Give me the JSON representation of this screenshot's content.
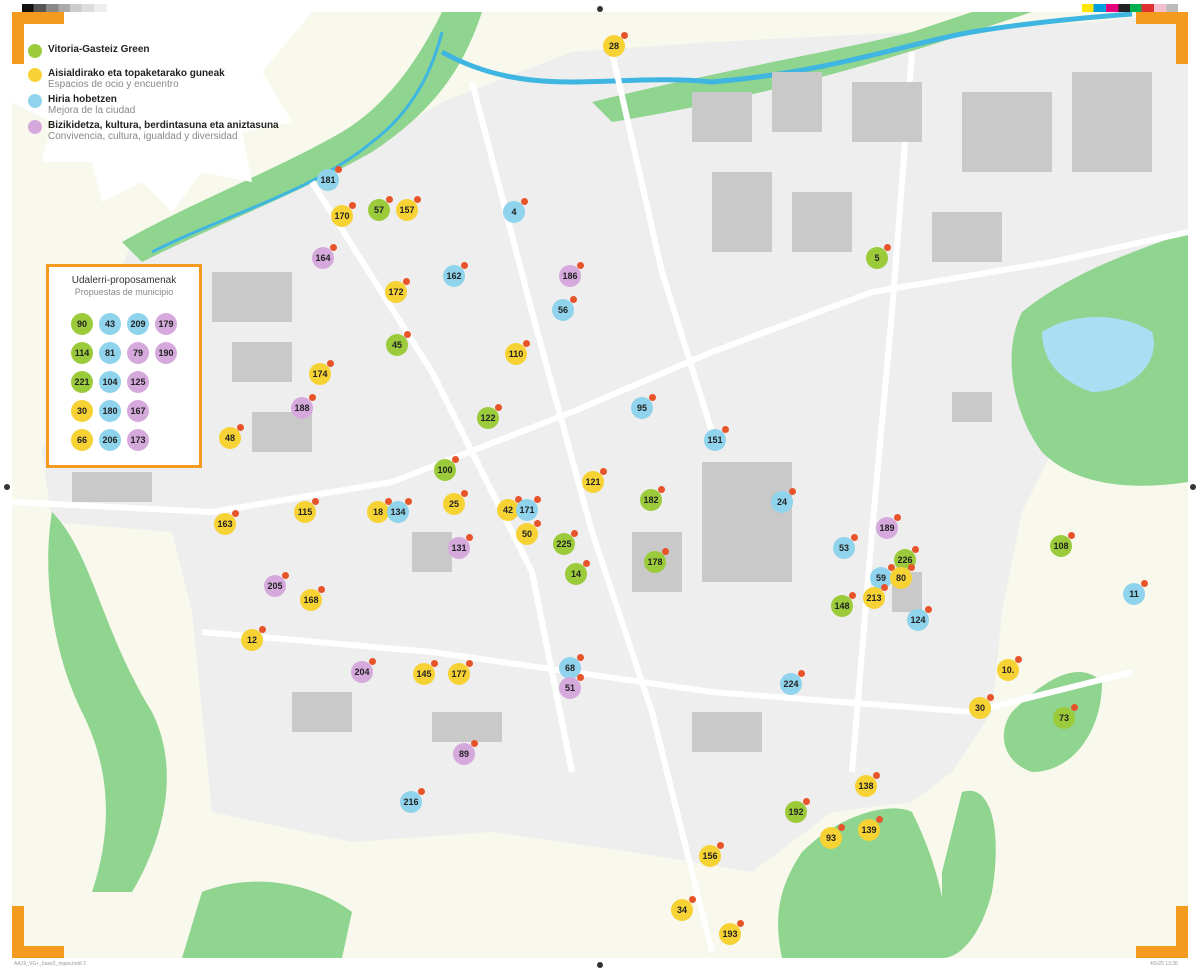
{
  "legend": {
    "items": [
      {
        "title": "Vitoria-Gasteiz Green",
        "subtitle": "",
        "color": "#9bcb3b"
      },
      {
        "title": "Aisialdirako eta topaketarako guneak",
        "subtitle": "Espacios de ocio y encuentro",
        "color": "#f7d234"
      },
      {
        "title": "Hiria hobetzen",
        "subtitle": "Mejora de la ciudad",
        "color": "#8fd3ec"
      },
      {
        "title": "Bizikidetza, kultura, berdintasuna eta aniztasuna",
        "subtitle": "Convivencia, cultura, igualdad y diversidad",
        "color": "#d6a9dd"
      }
    ]
  },
  "municipal": {
    "title": "Udalerri-proposamenak",
    "subtitle": "Propuestas de municipio",
    "chips": [
      {
        "label": "90",
        "cat": "green"
      },
      {
        "label": "43",
        "cat": "blue"
      },
      {
        "label": "209",
        "cat": "blue"
      },
      {
        "label": "179",
        "cat": "purple"
      },
      {
        "label": "114",
        "cat": "green"
      },
      {
        "label": "81",
        "cat": "blue"
      },
      {
        "label": "79",
        "cat": "purple"
      },
      {
        "label": "190",
        "cat": "purple"
      },
      {
        "label": "221",
        "cat": "green"
      },
      {
        "label": "104",
        "cat": "blue"
      },
      {
        "label": "125",
        "cat": "purple"
      },
      {
        "label": "30",
        "cat": "yellow"
      },
      {
        "label": "180",
        "cat": "blue"
      },
      {
        "label": "167",
        "cat": "purple"
      },
      {
        "label": "66",
        "cat": "yellow"
      },
      {
        "label": "206",
        "cat": "blue"
      },
      {
        "label": "173",
        "cat": "purple"
      }
    ]
  },
  "markers": [
    {
      "label": "28",
      "cat": "yellow"
    },
    {
      "label": "181",
      "cat": "blue"
    },
    {
      "label": "170",
      "cat": "yellow"
    },
    {
      "label": "57",
      "cat": "green"
    },
    {
      "label": "157",
      "cat": "yellow"
    },
    {
      "label": "4",
      "cat": "blue"
    },
    {
      "label": "164",
      "cat": "purple"
    },
    {
      "label": "162",
      "cat": "blue"
    },
    {
      "label": "186",
      "cat": "purple"
    },
    {
      "label": "5",
      "cat": "green"
    },
    {
      "label": "172",
      "cat": "yellow"
    },
    {
      "label": "56",
      "cat": "blue"
    },
    {
      "label": "45",
      "cat": "green"
    },
    {
      "label": "110",
      "cat": "yellow"
    },
    {
      "label": "174",
      "cat": "yellow"
    },
    {
      "label": "188",
      "cat": "purple"
    },
    {
      "label": "95",
      "cat": "blue"
    },
    {
      "label": "122",
      "cat": "green"
    },
    {
      "label": "48",
      "cat": "yellow"
    },
    {
      "label": "151",
      "cat": "blue"
    },
    {
      "label": "100",
      "cat": "green"
    },
    {
      "label": "121",
      "cat": "yellow"
    },
    {
      "label": "182",
      "cat": "green"
    },
    {
      "label": "24",
      "cat": "blue"
    },
    {
      "label": "25",
      "cat": "yellow"
    },
    {
      "label": "163",
      "cat": "yellow"
    },
    {
      "label": "115",
      "cat": "yellow"
    },
    {
      "label": "18",
      "cat": "yellow"
    },
    {
      "label": "134",
      "cat": "blue"
    },
    {
      "label": "42",
      "cat": "yellow"
    },
    {
      "label": "171",
      "cat": "blue"
    },
    {
      "label": "50",
      "cat": "yellow"
    },
    {
      "label": "189",
      "cat": "purple"
    },
    {
      "label": "131",
      "cat": "purple"
    },
    {
      "label": "225",
      "cat": "green"
    },
    {
      "label": "53",
      "cat": "blue"
    },
    {
      "label": "108",
      "cat": "green"
    },
    {
      "label": "178",
      "cat": "green"
    },
    {
      "label": "226",
      "cat": "green"
    },
    {
      "label": "14",
      "cat": "green"
    },
    {
      "label": "59",
      "cat": "blue"
    },
    {
      "label": "80",
      "cat": "yellow"
    },
    {
      "label": "205",
      "cat": "purple"
    },
    {
      "label": "168",
      "cat": "yellow"
    },
    {
      "label": "213",
      "cat": "yellow"
    },
    {
      "label": "148",
      "cat": "green"
    },
    {
      "label": "11",
      "cat": "blue"
    },
    {
      "label": "124",
      "cat": "blue"
    },
    {
      "label": "12",
      "cat": "yellow"
    },
    {
      "label": "68",
      "cat": "blue"
    },
    {
      "label": "204",
      "cat": "purple"
    },
    {
      "label": "145",
      "cat": "yellow"
    },
    {
      "label": "177",
      "cat": "yellow"
    },
    {
      "label": "10.",
      "cat": "yellow"
    },
    {
      "label": "51",
      "cat": "purple"
    },
    {
      "label": "224",
      "cat": "blue"
    },
    {
      "label": "30",
      "cat": "yellow"
    },
    {
      "label": "73",
      "cat": "green"
    },
    {
      "label": "89",
      "cat": "purple"
    },
    {
      "label": "138",
      "cat": "yellow"
    },
    {
      "label": "216",
      "cat": "blue"
    },
    {
      "label": "192",
      "cat": "green"
    },
    {
      "label": "139",
      "cat": "yellow"
    },
    {
      "label": "93",
      "cat": "yellow"
    },
    {
      "label": "156",
      "cat": "yellow"
    },
    {
      "label": "34",
      "cat": "yellow"
    },
    {
      "label": "193",
      "cat": "yellow"
    }
  ],
  "footer": {
    "left": "AA19_VG+_base2_mapa.indd 2",
    "right": "4/5/25 13:36"
  }
}
